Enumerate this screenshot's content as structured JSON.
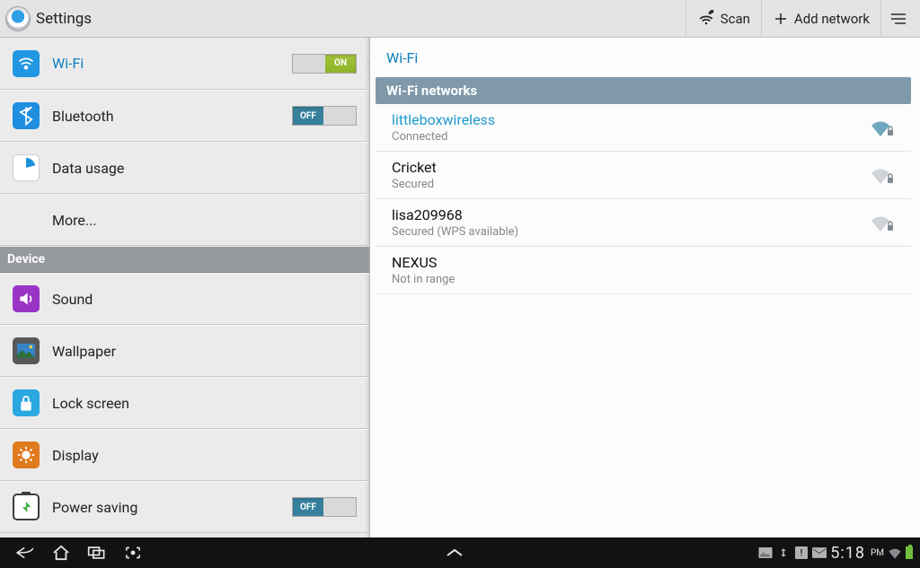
{
  "topbar": {
    "title": "Settings",
    "scan_label": "Scan",
    "add_label": "Add network"
  },
  "left": {
    "wifi_label": "Wi-Fi",
    "wifi_toggle": "ON",
    "bt_label": "Bluetooth",
    "bt_toggle": "OFF",
    "data_label": "Data usage",
    "more_label": "More...",
    "device_header": "Device",
    "sound_label": "Sound",
    "wallpaper_label": "Wallpaper",
    "lock_label": "Lock screen",
    "display_label": "Display",
    "power_label": "Power saving",
    "power_toggle": "OFF"
  },
  "right": {
    "title": "Wi-Fi",
    "section": "Wi-Fi networks",
    "networks": [
      {
        "ssid": "littleboxwireless",
        "status": "Connected",
        "connected": true,
        "secured": true,
        "signal": 3
      },
      {
        "ssid": "Cricket",
        "status": "Secured",
        "connected": false,
        "secured": true,
        "signal": 1
      },
      {
        "ssid": "lisa209968",
        "status": "Secured (WPS available)",
        "connected": false,
        "secured": true,
        "signal": 1
      },
      {
        "ssid": "NEXUS",
        "status": "Not in range",
        "connected": false,
        "secured": false,
        "signal": 0
      }
    ]
  },
  "navbar": {
    "time": "5:18",
    "ampm": "PM"
  }
}
